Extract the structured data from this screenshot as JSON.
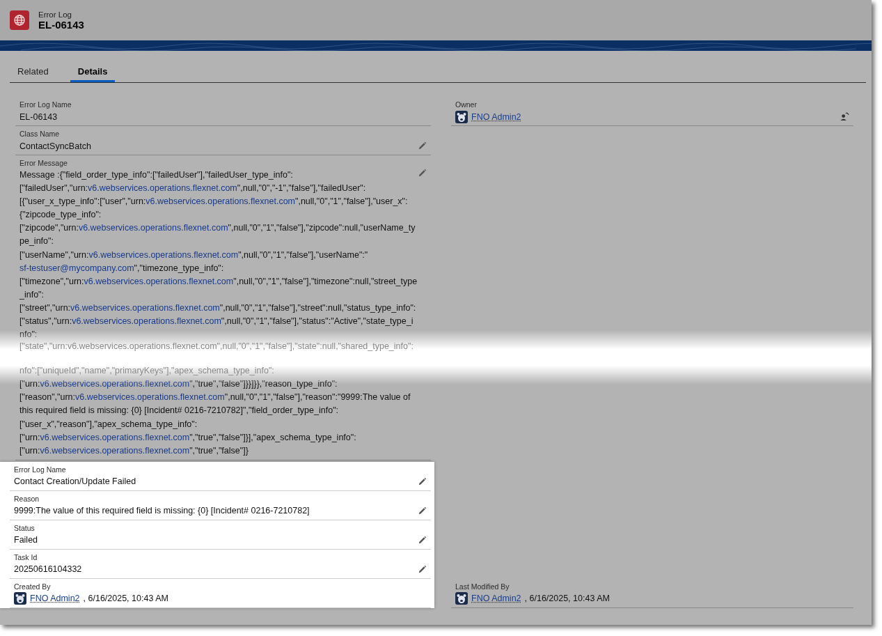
{
  "header": {
    "object_type": "Error Log",
    "record_name": "EL-06143"
  },
  "tabs": [
    {
      "label": "Related",
      "selected": false
    },
    {
      "label": "Details",
      "selected": true
    }
  ],
  "left_fields": [
    {
      "kind": "text",
      "label": "Error Log Name",
      "value": "EL-06143",
      "editable": false
    },
    {
      "kind": "text",
      "label": "Class Name",
      "value": "ContactSyncBatch",
      "editable": true
    },
    {
      "kind": "message",
      "label": "Error Message",
      "editable": true,
      "before_tear": [
        {
          "text": "Message :{\"field_order_type_info\":[\"failedUser\"],\"failedUser_type_info\":[\"failedUser\",\"urn:"
        },
        {
          "link": "v6.webservices.operations.flexnet.com"
        },
        {
          "text": "\",null,\"0\",\"-1\",\"false\"],\"failedUser\":[{\"user_x_type_info\":[\"user\",\"urn:"
        },
        {
          "link": "v6.webservices.operations.flexnet.com"
        },
        {
          "text": "\",null,\"0\",\"1\",\"false\"],\"user_x\":{\"zipcode_type_info\":[\"zipcode\",\"urn:"
        },
        {
          "link": "v6.webservices.operations.flexnet.com"
        },
        {
          "text": "\",null,\"0\",\"1\",\"false\"],\"zipcode\":null,\"userName_type_info\":[\"userName\",\"urn:"
        },
        {
          "link": "v6.webservices.operations.flexnet.com"
        },
        {
          "text": "\",null,\"0\",\"1\",\"false\"],\"userName\":\""
        },
        {
          "link": "sf-testuser@mycompany.com"
        },
        {
          "text": "\",\"timezone_type_info\":[\"timezone\",\"urn:"
        },
        {
          "link": "v6.webservices.operations.flexnet.com"
        },
        {
          "text": "\",null,\"0\",\"1\",\"false\"],\"timezone\":null,\"street_type_info\":[\"street\",\"urn:"
        },
        {
          "link": "v6.webservices.operations.flexnet.com"
        },
        {
          "text": "\",null,\"0\",\"1\",\"false\"],\"street\":null,\"status_type_info\":[\"status\",\"urn:"
        },
        {
          "link": "v6.webservices.operations.flexnet.com"
        },
        {
          "text": "\",null,\"0\",\"1\",\"false\"],\"status\":\"Active\",\"state_type_info\":"
        }
      ],
      "faded_lines": [
        "[\"state\",\"urn:v6.webservices.operations.flexnet.com\",null,\"0\",\"1\",\"false\"],\"state\":null,\"shared_type_info\":",
        "nfo\":[\"uniqueId\",\"name\",\"primaryKeys\"],\"apex_schema_type_info\":"
      ],
      "after_tear": [
        {
          "text": "[\"urn:"
        },
        {
          "link": "v6.webservices.operations.flexnet.com"
        },
        {
          "text": "\",\"true\",\"false\"]}}]}},\"reason_type_info\":[\"reason\",\"urn:"
        },
        {
          "link": "v6.webservices.operations.flexnet.com"
        },
        {
          "text": "\",null,\"0\",\"1\",\"false\"],\"reason\":\"9999:The value of this required field is missing: {0} [Incident# 0216-7210782]\",\"field_order_type_info\":[\"user_x\",\"reason\"],\"apex_schema_type_info\":[\"urn:"
        },
        {
          "link": "v6.webservices.operations.flexnet.com"
        },
        {
          "text": "\",\"true\",\"false\"]}],\"apex_schema_type_info\":[\"urn:"
        },
        {
          "link": "v6.webservices.operations.flexnet.com"
        },
        {
          "text": "\",\"true\",\"false\"]}"
        }
      ]
    }
  ],
  "highlighted_fields": [
    {
      "kind": "text",
      "label": "Error Log Name",
      "value": "Contact Creation/Update Failed",
      "editable": true
    },
    {
      "kind": "text",
      "label": "Reason",
      "value": "9999:The value of this required field is missing: {0} [Incident# 0216-7210782]",
      "editable": true
    },
    {
      "kind": "text",
      "label": "Status",
      "value": "Failed",
      "editable": true
    },
    {
      "kind": "text",
      "label": "Task Id",
      "value": "20250616104332",
      "editable": true
    },
    {
      "kind": "user",
      "label": "Created By",
      "user": "FNO Admin2",
      "timestamp": ", 6/16/2025, 10:43 AM",
      "editable": false
    }
  ],
  "right_top_fields": [
    {
      "kind": "owner",
      "label": "Owner",
      "user": "FNO Admin2",
      "editable": true
    }
  ],
  "right_bottom_fields": [
    {
      "kind": "user",
      "label": "Last Modified By",
      "user": "FNO Admin2",
      "timestamp": ", 6/16/2025, 10:43 AM",
      "editable": false
    }
  ]
}
